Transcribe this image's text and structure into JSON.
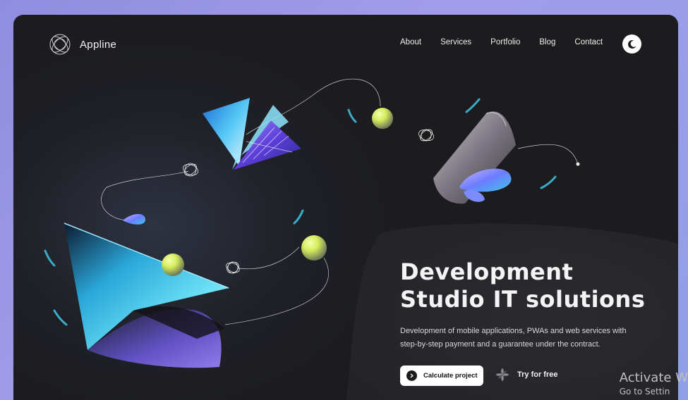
{
  "brand": {
    "name": "Appline",
    "logo_icon": "orbit-logo-icon"
  },
  "nav": {
    "items": [
      {
        "label": "About"
      },
      {
        "label": "Services"
      },
      {
        "label": "Portfolio"
      },
      {
        "label": "Blog"
      },
      {
        "label": "Contact"
      }
    ],
    "theme_toggle_icon": "moon-icon"
  },
  "hero": {
    "title_line1": "Development",
    "title_line2": "Studio IT solutions",
    "subtitle_line1": "Development of mobile applications, PWAs and web services with",
    "subtitle_line2": "step-by-step payment and a guarantee under the contract.",
    "primary_cta": {
      "label": "Calculate project",
      "icon": "chevron-right-icon"
    },
    "secondary_cta": {
      "label": "Try for free",
      "icon": "sparkle-icon"
    }
  },
  "os_watermark": {
    "line1": "Activate W",
    "line2": "Go to Settin"
  },
  "colors": {
    "page_bg": "#1c1c1f",
    "accent_cyan": "#3ec6e8",
    "accent_violet": "#7a5cff",
    "ball": "#d8ef6a"
  }
}
